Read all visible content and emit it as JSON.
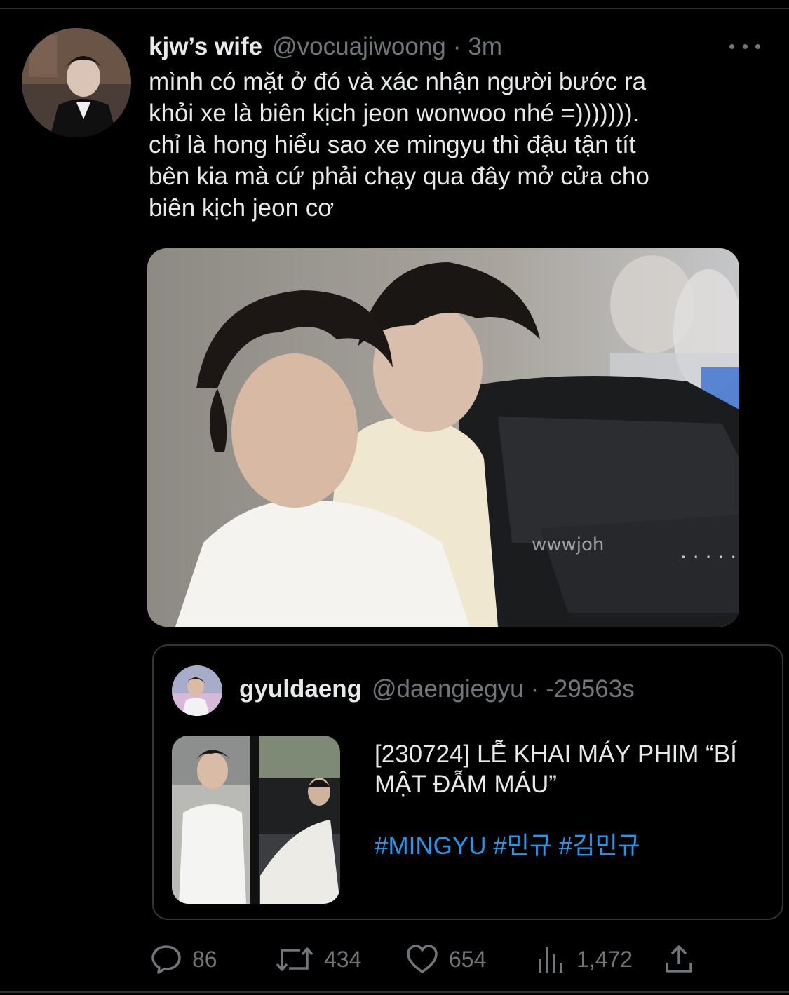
{
  "tweet": {
    "display_name": "kjw’s wife",
    "handle": "@vocuajiwoong",
    "separator": "·",
    "time": "3m",
    "text": "mình có mặt ở đó và xác nhận người bước ra\nkhỏi xe là biên kịch jeon wonwoo nhé =))))))).\nchỉ là hong hiểu sao xe mingyu thì đậu tận tít\nbên kia mà cứ phải chạy qua đây mở cửa cho\nbiên kịch jeon cơ",
    "media_watermark": "wwwjoh"
  },
  "quoted": {
    "display_name": "gyuldaeng",
    "handle": "@daengiegyu",
    "separator": "·",
    "time": "-29563s",
    "title": "[230724] LỄ KHAI MÁY PHIM “BÍ MẬT ĐẪM MÁU”",
    "hashtags": "#MINGYU #민규 #김민규"
  },
  "actions": {
    "replies": "86",
    "retweets": "434",
    "likes": "654",
    "views": "1,472"
  },
  "colors": {
    "background": "#000000",
    "text": "#e7e9ea",
    "secondary": "#71767b",
    "link": "#1d9bf0",
    "border": "#333639"
  },
  "icons": [
    "more-icon",
    "reply-icon",
    "retweet-icon",
    "like-icon",
    "views-icon",
    "share-icon"
  ]
}
